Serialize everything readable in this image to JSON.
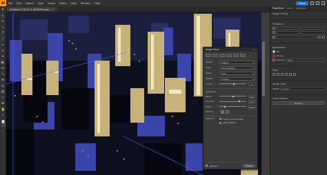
{
  "app": {
    "logo_text": "Ai",
    "menu": [
      "File",
      "Edit",
      "Object",
      "Type",
      "Select",
      "Effect",
      "View",
      "Window",
      "Help"
    ],
    "share_label": "Share"
  },
  "document": {
    "tab_title": "Untitled-1* @ 50 % (RGB/Preview)",
    "close_glyph": "×"
  },
  "image_trace": {
    "title": "Image Trace",
    "close_glyph": "×",
    "preset_label": "Preset:",
    "preset_value": "Custom",
    "view_label": "View:",
    "view_value": "Tracing Result",
    "mode_label": "Mode:",
    "mode_value": "Color",
    "palette_label": "Palette:",
    "palette_value": "Limited",
    "colors_label": "Colors:",
    "colors_value": "6",
    "colors_fraction": 0.55,
    "advanced_label": "Advanced",
    "paths_label": "Paths:",
    "paths_value": "50%",
    "paths_fraction": 0.5,
    "corners_label": "Corners:",
    "corners_value": "75%",
    "corners_fraction": 0.75,
    "noise_label": "Noise:",
    "noise_value": "25 px",
    "noise_fraction": 0.2,
    "method_label": "Method:",
    "options_label": "Options:",
    "snap_curves_label": "Snap Curves To Lines",
    "ignore_white_label": "Ignore White",
    "preview_label": "Preview",
    "trace_label": "Trace"
  },
  "right_panel": {
    "tabs": [
      "Properties",
      "Layers",
      "Libraries"
    ],
    "section_image_tracing": "Image Tracing",
    "section_transform": "Transform",
    "section_appearance": "Appearance",
    "fill_label": "Fill",
    "stroke_label": "Stroke",
    "opacity_label": "Opacity",
    "opacity_value": "100%",
    "section_align": "Align",
    "section_image_trace": "Image Trace",
    "preset_label": "Preset",
    "preset_value": "6 Colors",
    "section_quick_actions": "Quick Actions",
    "expand_label": "Expand"
  }
}
